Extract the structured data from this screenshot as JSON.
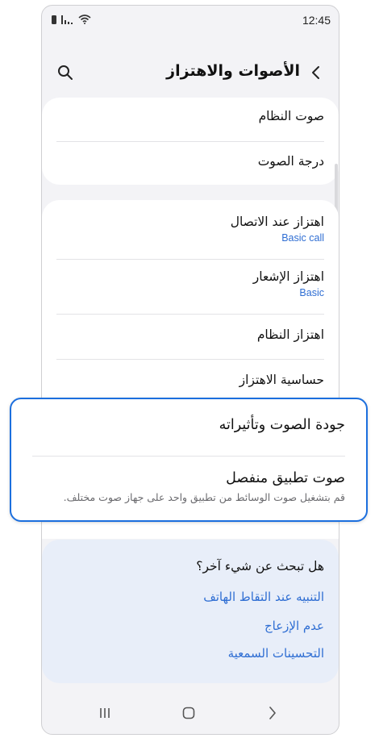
{
  "status_bar": {
    "time": "12:45"
  },
  "header": {
    "title": "الأصوات والاهتزاز"
  },
  "group1": {
    "items": [
      {
        "title": "صوت النظام"
      },
      {
        "title": "درجة الصوت"
      }
    ]
  },
  "group2": {
    "items": [
      {
        "title": "اهتزاز عند الاتصال",
        "sub": "Basic call"
      },
      {
        "title": "اهتزاز الإشعار",
        "sub": "Basic"
      },
      {
        "title": "اهتزاز النظام"
      },
      {
        "title": "حساسية الاهتزاز"
      }
    ]
  },
  "highlighted": {
    "item1": {
      "title": "جودة الصوت وتأثيراته"
    },
    "item2": {
      "title": "صوت تطبيق منفصل",
      "desc": "قم بتشغيل صوت الوسائط من تطبيق واحد على جهاز صوت مختلف."
    }
  },
  "looking_for": {
    "question": "هل تبحث عن شيء آخر؟",
    "links": [
      "التنبيه عند التقاط الهاتف",
      "عدم الإزعاج",
      "التحسينات السمعية"
    ]
  },
  "colors": {
    "accent": "#2f6ed3",
    "highlight_border": "#1c6fde",
    "background": "#f3f3f6",
    "panel": "#e8eef9"
  }
}
